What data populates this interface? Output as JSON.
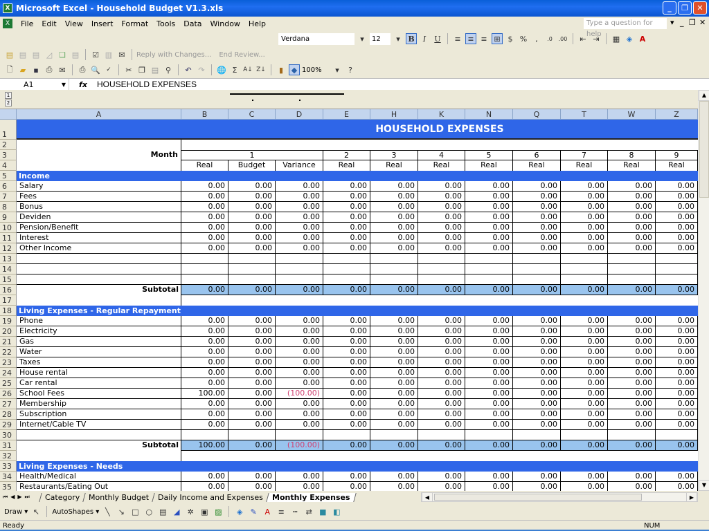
{
  "window": {
    "title": "Microsoft Excel - Household Budget V1.3.xls",
    "minimize": "_",
    "restore": "❐",
    "close": "✕"
  },
  "menubar": {
    "items": [
      "File",
      "Edit",
      "View",
      "Insert",
      "Format",
      "Tools",
      "Data",
      "Window",
      "Help"
    ],
    "help_placeholder": "Type a question for help",
    "doc_controls": [
      "▾",
      "_",
      "❐",
      "✕"
    ]
  },
  "format_toolbar": {
    "font": "Verdana",
    "size": "12",
    "buttons": [
      {
        "name": "bold",
        "glyph": "B"
      },
      {
        "name": "italic",
        "glyph": "I"
      },
      {
        "name": "underline",
        "glyph": "U"
      },
      {
        "name": "align-left",
        "glyph": "≡"
      },
      {
        "name": "align-center",
        "glyph": "≡"
      },
      {
        "name": "align-right",
        "glyph": "≡"
      },
      {
        "name": "merge-center",
        "glyph": "⊞"
      },
      {
        "name": "currency",
        "glyph": "$"
      },
      {
        "name": "percent",
        "glyph": "%"
      },
      {
        "name": "comma",
        "glyph": ","
      },
      {
        "name": "increase-decimal",
        "glyph": ".0"
      },
      {
        "name": "decrease-decimal",
        "glyph": ".00"
      },
      {
        "name": "decrease-indent",
        "glyph": "⇤"
      },
      {
        "name": "increase-indent",
        "glyph": "⇥"
      },
      {
        "name": "borders",
        "glyph": "▦"
      },
      {
        "name": "fill-color",
        "glyph": "◈"
      },
      {
        "name": "font-color",
        "glyph": "A"
      }
    ]
  },
  "review_toolbar": {
    "reply_label": "Reply with Changes...",
    "end_review_label": "End Review..."
  },
  "standard_toolbar": {
    "zoom": "100%"
  },
  "formula_bar": {
    "name_box": "A1",
    "fx": "fx",
    "content": "HOUSEHOLD EXPENSES"
  },
  "outline_levels": [
    "1",
    "2"
  ],
  "columns": [
    "A",
    "B",
    "C",
    "D",
    "E",
    "H",
    "K",
    "N",
    "Q",
    "T",
    "W",
    "Z"
  ],
  "sheet": {
    "title": "HOUSEHOLD EXPENSES",
    "month_label": "Month",
    "months": [
      "1",
      "2",
      "3",
      "4",
      "5",
      "6",
      "7",
      "8",
      "9"
    ],
    "subheaders": [
      "Real",
      "Budget",
      "Variance",
      "Real",
      "Real",
      "Real",
      "Real",
      "Real",
      "Real",
      "Real",
      "Real"
    ],
    "subtotal_label": "Subtotal",
    "sections": [
      {
        "row": 5,
        "title": "Income"
      },
      {
        "row": 18,
        "title": "Living Expenses - Regular Repayment"
      },
      {
        "row": 33,
        "title": "Living Expenses - Needs"
      }
    ],
    "rows": [
      {
        "row": 6,
        "label": "Salary",
        "values": [
          "0.00",
          "0.00",
          "0.00",
          "0.00",
          "0.00",
          "0.00",
          "0.00",
          "0.00",
          "0.00",
          "0.00",
          "0.00"
        ]
      },
      {
        "row": 7,
        "label": "Fees",
        "values": [
          "0.00",
          "0.00",
          "0.00",
          "0.00",
          "0.00",
          "0.00",
          "0.00",
          "0.00",
          "0.00",
          "0.00",
          "0.00"
        ]
      },
      {
        "row": 8,
        "label": "Bonus",
        "values": [
          "0.00",
          "0.00",
          "0.00",
          "0.00",
          "0.00",
          "0.00",
          "0.00",
          "0.00",
          "0.00",
          "0.00",
          "0.00"
        ]
      },
      {
        "row": 9,
        "label": "Deviden",
        "values": [
          "0.00",
          "0.00",
          "0.00",
          "0.00",
          "0.00",
          "0.00",
          "0.00",
          "0.00",
          "0.00",
          "0.00",
          "0.00"
        ]
      },
      {
        "row": 10,
        "label": "Pension/Benefit",
        "values": [
          "0.00",
          "0.00",
          "0.00",
          "0.00",
          "0.00",
          "0.00",
          "0.00",
          "0.00",
          "0.00",
          "0.00",
          "0.00"
        ]
      },
      {
        "row": 11,
        "label": "Interest",
        "values": [
          "0.00",
          "0.00",
          "0.00",
          "0.00",
          "0.00",
          "0.00",
          "0.00",
          "0.00",
          "0.00",
          "0.00",
          "0.00"
        ]
      },
      {
        "row": 12,
        "label": "Other Income",
        "values": [
          "0.00",
          "0.00",
          "0.00",
          "0.00",
          "0.00",
          "0.00",
          "0.00",
          "0.00",
          "0.00",
          "0.00",
          "0.00"
        ]
      },
      {
        "row": 13,
        "label": "",
        "values": [
          "",
          "",
          "",
          "",
          "",
          "",
          "",
          "",
          "",
          "",
          ""
        ]
      },
      {
        "row": 14,
        "label": "",
        "values": [
          "",
          "",
          "",
          "",
          "",
          "",
          "",
          "",
          "",
          "",
          ""
        ]
      },
      {
        "row": 15,
        "label": "",
        "values": [
          "",
          "",
          "",
          "",
          "",
          "",
          "",
          "",
          "",
          "",
          ""
        ]
      },
      {
        "row": 16,
        "label": "Subtotal",
        "subtotal": true,
        "values": [
          "0.00",
          "0.00",
          "0.00",
          "0.00",
          "0.00",
          "0.00",
          "0.00",
          "0.00",
          "0.00",
          "0.00",
          "0.00"
        ]
      },
      {
        "row": 19,
        "label": "Phone",
        "values": [
          "0.00",
          "0.00",
          "0.00",
          "0.00",
          "0.00",
          "0.00",
          "0.00",
          "0.00",
          "0.00",
          "0.00",
          "0.00"
        ]
      },
      {
        "row": 20,
        "label": "Electricity",
        "values": [
          "0.00",
          "0.00",
          "0.00",
          "0.00",
          "0.00",
          "0.00",
          "0.00",
          "0.00",
          "0.00",
          "0.00",
          "0.00"
        ]
      },
      {
        "row": 21,
        "label": "Gas",
        "values": [
          "0.00",
          "0.00",
          "0.00",
          "0.00",
          "0.00",
          "0.00",
          "0.00",
          "0.00",
          "0.00",
          "0.00",
          "0.00"
        ]
      },
      {
        "row": 22,
        "label": "Water",
        "values": [
          "0.00",
          "0.00",
          "0.00",
          "0.00",
          "0.00",
          "0.00",
          "0.00",
          "0.00",
          "0.00",
          "0.00",
          "0.00"
        ]
      },
      {
        "row": 23,
        "label": "Taxes",
        "values": [
          "0.00",
          "0.00",
          "0.00",
          "0.00",
          "0.00",
          "0.00",
          "0.00",
          "0.00",
          "0.00",
          "0.00",
          "0.00"
        ]
      },
      {
        "row": 24,
        "label": "House rental",
        "values": [
          "0.00",
          "0.00",
          "0.00",
          "0.00",
          "0.00",
          "0.00",
          "0.00",
          "0.00",
          "0.00",
          "0.00",
          "0.00"
        ]
      },
      {
        "row": 25,
        "label": "Car rental",
        "values": [
          "0.00",
          "0.00",
          "0.00",
          "0.00",
          "0.00",
          "0.00",
          "0.00",
          "0.00",
          "0.00",
          "0.00",
          "0.00"
        ]
      },
      {
        "row": 26,
        "label": "School Fees",
        "values": [
          "100.00",
          "0.00",
          "(100.00)",
          "0.00",
          "0.00",
          "0.00",
          "0.00",
          "0.00",
          "0.00",
          "0.00",
          "0.00"
        ]
      },
      {
        "row": 27,
        "label": "Membership",
        "values": [
          "0.00",
          "0.00",
          "0.00",
          "0.00",
          "0.00",
          "0.00",
          "0.00",
          "0.00",
          "0.00",
          "0.00",
          "0.00"
        ]
      },
      {
        "row": 28,
        "label": "Subscription",
        "values": [
          "0.00",
          "0.00",
          "0.00",
          "0.00",
          "0.00",
          "0.00",
          "0.00",
          "0.00",
          "0.00",
          "0.00",
          "0.00"
        ]
      },
      {
        "row": 29,
        "label": "Internet/Cable TV",
        "values": [
          "0.00",
          "0.00",
          "0.00",
          "0.00",
          "0.00",
          "0.00",
          "0.00",
          "0.00",
          "0.00",
          "0.00",
          "0.00"
        ]
      },
      {
        "row": 30,
        "label": "",
        "values": [
          "",
          "",
          "",
          "",
          "",
          "",
          "",
          "",
          "",
          "",
          ""
        ]
      },
      {
        "row": 31,
        "label": "Subtotal",
        "subtotal": true,
        "values": [
          "100.00",
          "0.00",
          "(100.00)",
          "0.00",
          "0.00",
          "0.00",
          "0.00",
          "0.00",
          "0.00",
          "0.00",
          "0.00"
        ]
      },
      {
        "row": 34,
        "label": "Health/Medical",
        "values": [
          "0.00",
          "0.00",
          "0.00",
          "0.00",
          "0.00",
          "0.00",
          "0.00",
          "0.00",
          "0.00",
          "0.00",
          "0.00"
        ]
      },
      {
        "row": 35,
        "label": "Restaurants/Eating Out",
        "values": [
          "0.00",
          "0.00",
          "0.00",
          "0.00",
          "0.00",
          "0.00",
          "0.00",
          "0.00",
          "0.00",
          "0.00",
          "0.00"
        ]
      }
    ],
    "negative_color": "#d04070",
    "section_color": "#2f66e8",
    "subtotal_color": "#99c4ee"
  },
  "sheet_tabs": [
    {
      "label": "Category",
      "active": false
    },
    {
      "label": "Monthly Budget",
      "active": false
    },
    {
      "label": "Daily Income and Expenses",
      "active": false
    },
    {
      "label": "Monthly Expenses",
      "active": true
    }
  ],
  "drawing_toolbar": {
    "draw_label": "Draw",
    "autoshapes_label": "AutoShapes"
  },
  "status": {
    "text": "Ready",
    "num_indicator": "NUM"
  }
}
